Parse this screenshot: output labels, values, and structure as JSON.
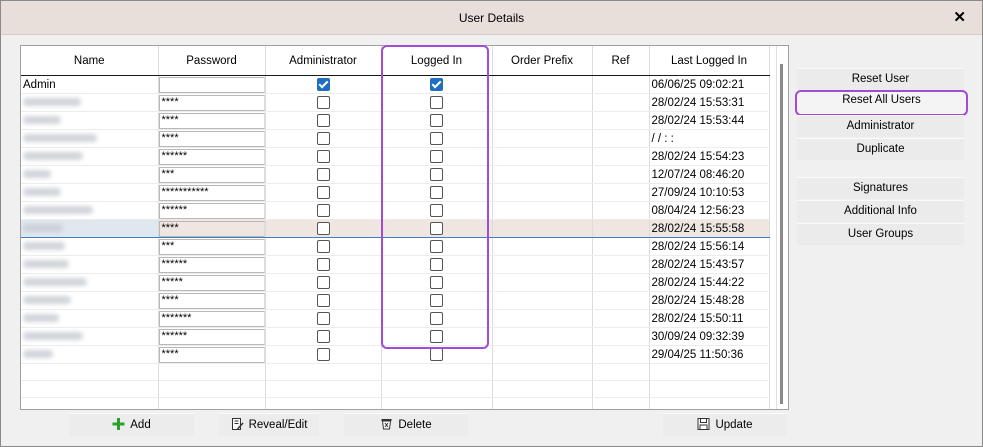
{
  "window": {
    "title": "User Details",
    "close_label": "✕"
  },
  "grid": {
    "columns": [
      "Name",
      "Password",
      "Administrator",
      "Logged In",
      "Order Prefix",
      "Ref",
      "Last Logged In"
    ],
    "rows": [
      {
        "name": "Admin",
        "password": "",
        "admin": true,
        "logged_in": true,
        "last": "06/06/25 09:02:21"
      },
      {
        "name": "",
        "password": "****",
        "admin": false,
        "logged_in": false,
        "last": "28/02/24 15:53:31"
      },
      {
        "name": "",
        "password": "****",
        "admin": false,
        "logged_in": false,
        "last": "28/02/24 15:53:44"
      },
      {
        "name": "",
        "password": "****",
        "admin": false,
        "logged_in": false,
        "last": "/ /   : :"
      },
      {
        "name": "",
        "password": "******",
        "admin": false,
        "logged_in": false,
        "last": "28/02/24 15:54:23"
      },
      {
        "name": "",
        "password": "***",
        "admin": false,
        "logged_in": false,
        "last": "12/07/24 08:46:20"
      },
      {
        "name": "",
        "password": "***********",
        "admin": false,
        "logged_in": false,
        "last": "27/09/24 10:10:53"
      },
      {
        "name": "",
        "password": "******",
        "admin": false,
        "logged_in": false,
        "last": "08/04/24 12:56:23"
      },
      {
        "name": "",
        "password": "****",
        "admin": false,
        "logged_in": false,
        "last": "28/02/24 15:55:58",
        "selected": true
      },
      {
        "name": "",
        "password": "***",
        "admin": false,
        "logged_in": false,
        "last": "28/02/24 15:56:14"
      },
      {
        "name": "",
        "password": "******",
        "admin": false,
        "logged_in": false,
        "last": "28/02/24 15:43:57"
      },
      {
        "name": "",
        "password": "*****",
        "admin": false,
        "logged_in": false,
        "last": "28/02/24 15:44:22"
      },
      {
        "name": "",
        "password": "****",
        "admin": false,
        "logged_in": false,
        "last": "28/02/24 15:48:28"
      },
      {
        "name": "",
        "password": "*******",
        "admin": false,
        "logged_in": false,
        "last": "28/02/24 15:50:11"
      },
      {
        "name": "",
        "password": "******",
        "admin": false,
        "logged_in": false,
        "last": "30/09/24 09:32:39"
      },
      {
        "name": "",
        "password": "****",
        "admin": false,
        "logged_in": false,
        "last": "29/04/25 11:50:36"
      }
    ],
    "empty_rows": 3
  },
  "side_buttons": {
    "reset_user": "Reset User",
    "reset_all_users": "Reset All Users",
    "administrator": "Administrator",
    "duplicate": "Duplicate",
    "signatures": "Signatures",
    "additional_info": "Additional Info",
    "user_groups": "User Groups"
  },
  "bottom_buttons": {
    "add": "Add",
    "reveal_edit": "Reveal/Edit",
    "delete": "Delete",
    "update": "Update"
  },
  "icons": {
    "add": "plus-icon",
    "reveal_edit": "edit-document-icon",
    "delete": "delete-bin-icon",
    "update": "save-disk-icon"
  },
  "colors": {
    "highlight": "#a24bd6",
    "checkbox_on": "#1e6fc0",
    "title_bar": "#e8dfdb",
    "add_icon": "#2ca02c"
  }
}
